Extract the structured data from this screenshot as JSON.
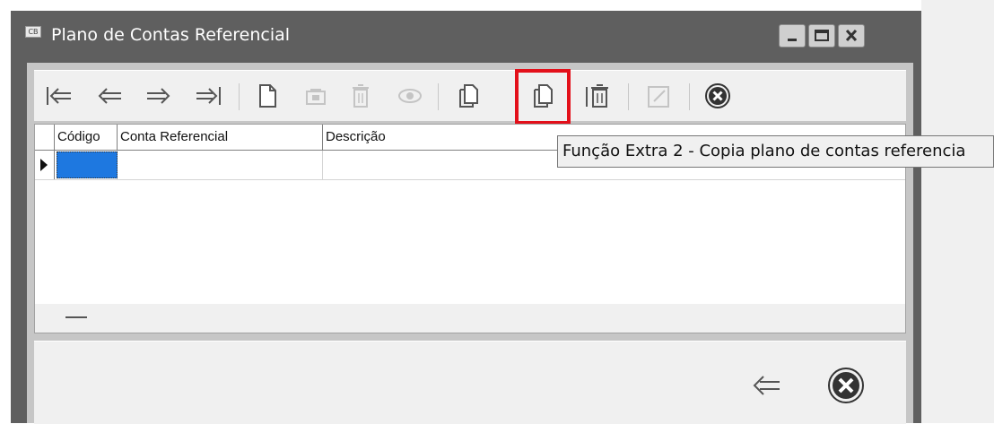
{
  "window": {
    "title": "Plano de Contas Referencial",
    "title_icon_text": "CB",
    "controls": [
      "minimize",
      "maximize",
      "close"
    ]
  },
  "toolbar": {
    "buttons": [
      {
        "name": "first-record-button",
        "icon": "arrow-first-icon",
        "enabled": true
      },
      {
        "name": "previous-record-button",
        "icon": "arrow-left-icon",
        "enabled": true
      },
      {
        "name": "next-record-button",
        "icon": "arrow-right-icon",
        "enabled": true
      },
      {
        "name": "last-record-button",
        "icon": "arrow-last-icon",
        "enabled": true
      },
      {
        "name": "new-record-button",
        "icon": "document-icon",
        "enabled": true
      },
      {
        "name": "edit-record-button",
        "icon": "edit-icon",
        "enabled": false
      },
      {
        "name": "delete-record-button",
        "icon": "trash-icon",
        "enabled": false
      },
      {
        "name": "view-record-button",
        "icon": "eye-icon",
        "enabled": false
      },
      {
        "name": "extra-function-1-button",
        "icon": "copy-document-icon",
        "enabled": true
      },
      {
        "name": "extra-function-2-button",
        "icon": "copy-document-icon",
        "enabled": true,
        "highlighted": true
      },
      {
        "name": "delete-all-button",
        "icon": "trash-bars-icon",
        "enabled": true
      },
      {
        "name": "confirm-button",
        "icon": "pencil-box-icon",
        "enabled": false
      },
      {
        "name": "close-button",
        "icon": "circle-x-icon",
        "enabled": true
      }
    ]
  },
  "tooltip": {
    "text": "Função Extra 2 - Copia plano de contas referencia"
  },
  "grid": {
    "columns": [
      "Código",
      "Conta Referencial",
      "Descrição"
    ],
    "rows": [
      {
        "codigo": "",
        "conta_referencial": "",
        "descricao": ""
      }
    ]
  },
  "footer": {
    "buttons": [
      {
        "name": "back-button",
        "icon": "arrow-first-icon"
      },
      {
        "name": "exit-button",
        "icon": "circle-x-icon"
      }
    ]
  },
  "colors": {
    "highlight": "#e3101a",
    "selection": "#1e78e0",
    "titlebar": "#5f5f5f"
  }
}
